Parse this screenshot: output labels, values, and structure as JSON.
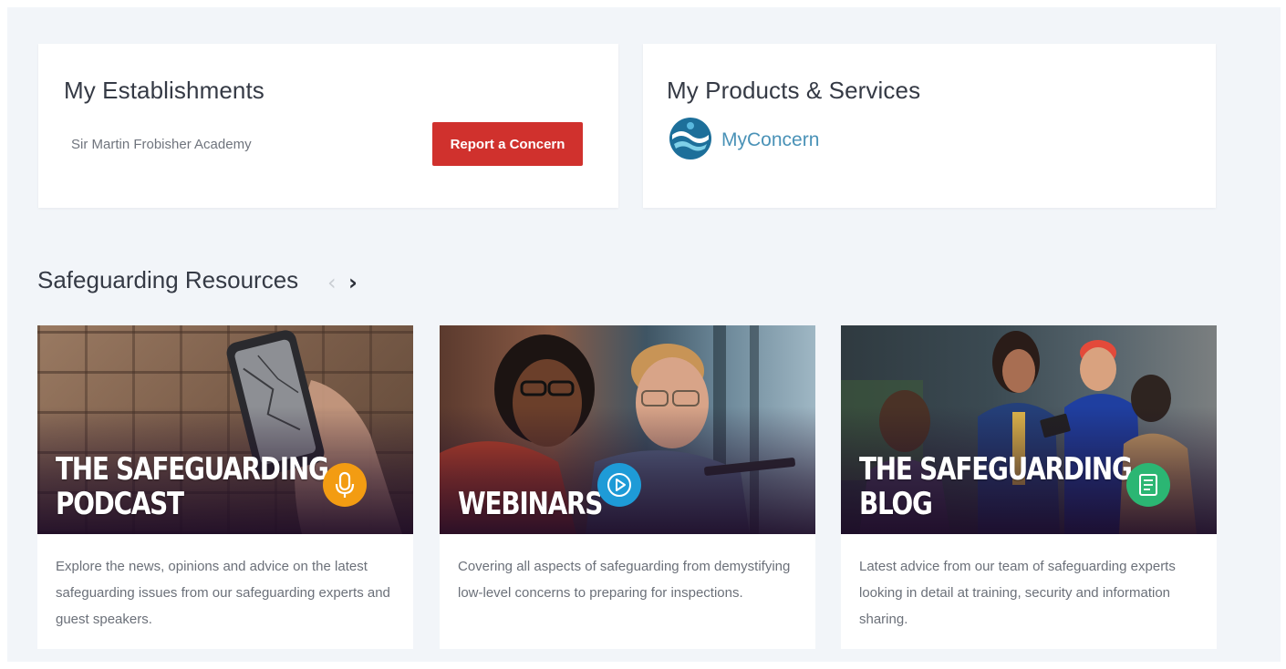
{
  "establishments": {
    "title": "My Establishments",
    "name": "Sir Martin Frobisher Academy",
    "report_label": "Report a Concern"
  },
  "products": {
    "title": "My Products & Services",
    "product_name": "MyConcern",
    "product_icon": "myconcern-logo"
  },
  "resources": {
    "title": "Safeguarding Resources",
    "prev_icon": "chevron-left-icon",
    "next_icon": "chevron-right-icon",
    "cards": [
      {
        "title_line1": "THE SAFEGUARDING",
        "title_line2": "PODCAST",
        "icon": "microphone-icon",
        "badge_color": "#f39c12",
        "description": "Explore the news, opinions and advice on the latest safeguarding issues from our safeguarding experts and guest speakers."
      },
      {
        "title_line1": "WEBINARS",
        "title_line2": "",
        "icon": "play-icon",
        "badge_color": "#1e9bd7",
        "description": "Covering all aspects of safeguarding from demystifying low-level concerns to preparing for inspections."
      },
      {
        "title_line1": "THE SAFEGUARDING",
        "title_line2": "BLOG",
        "icon": "document-icon",
        "badge_color": "#2bb673",
        "description": "Latest advice from our team of safeguarding experts looking in detail at training, security and information sharing."
      }
    ]
  },
  "colors": {
    "accent_red": "#d0312d",
    "brand_blue": "#4a92b7",
    "page_bg": "#f2f5f9"
  }
}
